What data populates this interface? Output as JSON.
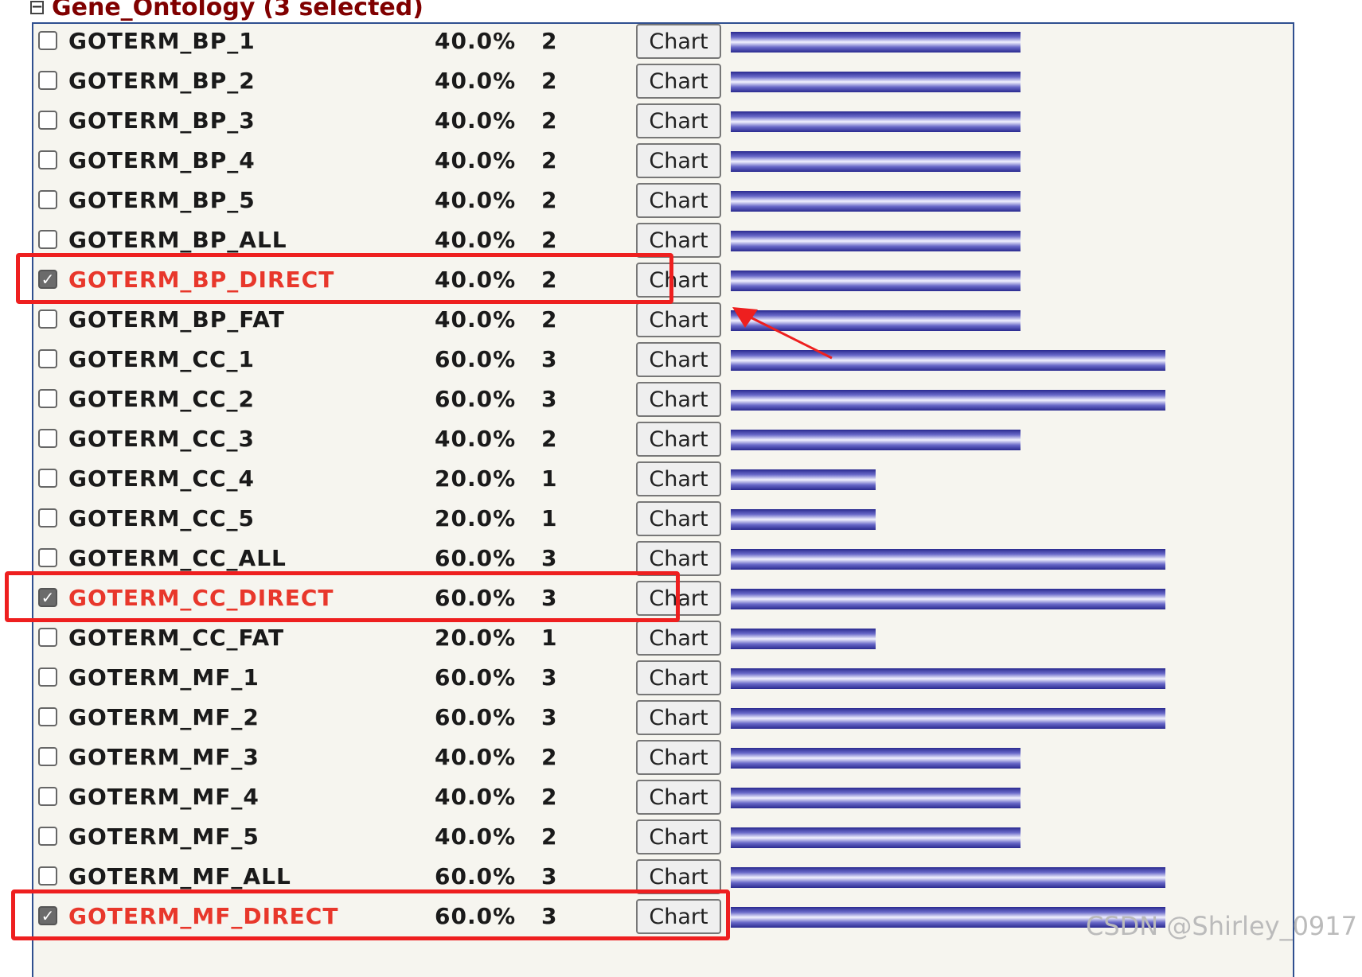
{
  "header": {
    "collapse_glyph": "−",
    "title": "Gene_Ontology",
    "selected_text": "(3 selected)"
  },
  "button_label": "Chart",
  "max_count": 3,
  "rows": [
    {
      "label": "GOTERM_BP_1",
      "percent": "40.0%",
      "count": "2",
      "checked": false
    },
    {
      "label": "GOTERM_BP_2",
      "percent": "40.0%",
      "count": "2",
      "checked": false
    },
    {
      "label": "GOTERM_BP_3",
      "percent": "40.0%",
      "count": "2",
      "checked": false
    },
    {
      "label": "GOTERM_BP_4",
      "percent": "40.0%",
      "count": "2",
      "checked": false
    },
    {
      "label": "GOTERM_BP_5",
      "percent": "40.0%",
      "count": "2",
      "checked": false
    },
    {
      "label": "GOTERM_BP_ALL",
      "percent": "40.0%",
      "count": "2",
      "checked": false
    },
    {
      "label": "GOTERM_BP_DIRECT",
      "percent": "40.0%",
      "count": "2",
      "checked": true
    },
    {
      "label": "GOTERM_BP_FAT",
      "percent": "40.0%",
      "count": "2",
      "checked": false
    },
    {
      "label": "GOTERM_CC_1",
      "percent": "60.0%",
      "count": "3",
      "checked": false
    },
    {
      "label": "GOTERM_CC_2",
      "percent": "60.0%",
      "count": "3",
      "checked": false
    },
    {
      "label": "GOTERM_CC_3",
      "percent": "40.0%",
      "count": "2",
      "checked": false
    },
    {
      "label": "GOTERM_CC_4",
      "percent": "20.0%",
      "count": "1",
      "checked": false
    },
    {
      "label": "GOTERM_CC_5",
      "percent": "20.0%",
      "count": "1",
      "checked": false
    },
    {
      "label": "GOTERM_CC_ALL",
      "percent": "60.0%",
      "count": "3",
      "checked": false
    },
    {
      "label": "GOTERM_CC_DIRECT",
      "percent": "60.0%",
      "count": "3",
      "checked": true
    },
    {
      "label": "GOTERM_CC_FAT",
      "percent": "20.0%",
      "count": "1",
      "checked": false
    },
    {
      "label": "GOTERM_MF_1",
      "percent": "60.0%",
      "count": "3",
      "checked": false
    },
    {
      "label": "GOTERM_MF_2",
      "percent": "60.0%",
      "count": "3",
      "checked": false
    },
    {
      "label": "GOTERM_MF_3",
      "percent": "40.0%",
      "count": "2",
      "checked": false
    },
    {
      "label": "GOTERM_MF_4",
      "percent": "40.0%",
      "count": "2",
      "checked": false
    },
    {
      "label": "GOTERM_MF_5",
      "percent": "40.0%",
      "count": "2",
      "checked": false
    },
    {
      "label": "GOTERM_MF_ALL",
      "percent": "60.0%",
      "count": "3",
      "checked": false
    },
    {
      "label": "GOTERM_MF_DIRECT",
      "percent": "60.0%",
      "count": "3",
      "checked": true
    }
  ],
  "colors": {
    "header_text": "#800000",
    "selected_label": "#e8372b",
    "annotation": "#ee1f1f",
    "bar_dark": "#2a2a8f"
  },
  "watermark": "CSDN @Shirley_0917"
}
